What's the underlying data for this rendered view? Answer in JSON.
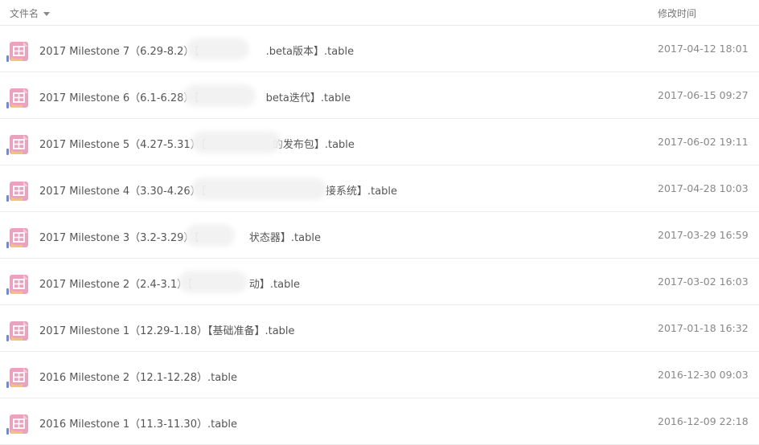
{
  "header": {
    "name_label": "文件名",
    "time_label": "修改时间"
  },
  "icon": {
    "name": "spreadsheet-file-icon",
    "colors": {
      "body": "#e9a3bf",
      "grid": "#ffffff",
      "fold": "#f4c9da",
      "hand": "#f3c17a",
      "tab": "#6e8bd6"
    }
  },
  "files": [
    {
      "name": "2017 Milestone 7（6.29-8.2）【                    .beta版本】.table",
      "modified": "2017-04-12 18:01"
    },
    {
      "name": "2017 Milestone 6（6.1-6.28）【                    beta迭代】.table",
      "modified": "2017-06-15 09:27"
    },
    {
      "name": "2017 Milestone 5（4.27-5.31）【                    的发布包】.table",
      "modified": "2017-06-02 19:11"
    },
    {
      "name": "2017 Milestone 4（3.30-4.26）【                                    接系统】.table",
      "modified": "2017-04-28 10:03"
    },
    {
      "name": "2017 Milestone 3（3.2-3.29）【               状态器】.table",
      "modified": "2017-03-29 16:59"
    },
    {
      "name": "2017 Milestone 2（2.4-3.1）【                 动】.table",
      "modified": "2017-03-02 16:03"
    },
    {
      "name": "2017 Milestone 1（12.29-1.18）【基础准备】.table",
      "modified": "2017-01-18 16:32"
    },
    {
      "name": "2016 Milestone 2（12.1-12.28）.table",
      "modified": "2016-12-30 09:03"
    },
    {
      "name": "2016 Milestone 1（11.3-11.30）.table",
      "modified": "2016-12-09 22:18"
    }
  ]
}
